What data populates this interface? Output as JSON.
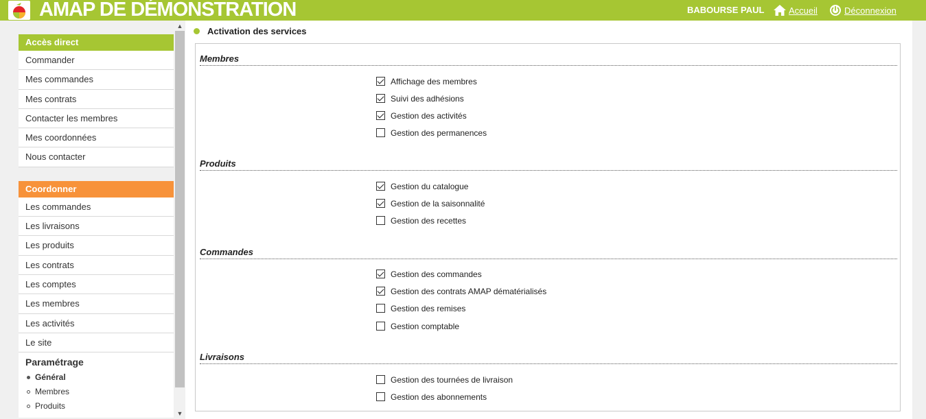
{
  "header": {
    "app_title": "AMAP DE DÉMONSTRATION",
    "user_name": "BABOURSE PAUL",
    "home_link": "Accueil",
    "logout_link": "Déconnexion",
    "brand_color": "#a6c633"
  },
  "sidebar": {
    "direct_access": {
      "title": "Accès direct",
      "items": [
        {
          "label": "Commander"
        },
        {
          "label": "Mes commandes"
        },
        {
          "label": "Mes contrats"
        },
        {
          "label": "Contacter les membres"
        },
        {
          "label": "Mes coordonnées"
        },
        {
          "label": "Nous contacter"
        }
      ]
    },
    "coordinate": {
      "title": "Coordonner",
      "color": "#f7923a",
      "items": [
        {
          "label": "Les commandes"
        },
        {
          "label": "Les livraisons"
        },
        {
          "label": "Les produits"
        },
        {
          "label": "Les contrats"
        },
        {
          "label": "Les comptes"
        },
        {
          "label": "Les membres"
        },
        {
          "label": "Les activités"
        },
        {
          "label": "Le site"
        }
      ]
    },
    "settings": {
      "title": "Paramétrage",
      "items": [
        {
          "label": "Général",
          "active": true
        },
        {
          "label": "Membres",
          "active": false
        },
        {
          "label": "Produits",
          "active": false
        }
      ]
    }
  },
  "main": {
    "title": "Activation des services",
    "groups": [
      {
        "title": "Membres",
        "services": [
          {
            "label": "Affichage des membres",
            "checked": true
          },
          {
            "label": "Suivi des adhésions",
            "checked": true
          },
          {
            "label": "Gestion des activités",
            "checked": true
          },
          {
            "label": "Gestion des permanences",
            "checked": false
          }
        ]
      },
      {
        "title": "Produits",
        "services": [
          {
            "label": "Gestion du catalogue",
            "checked": true
          },
          {
            "label": "Gestion de la saisonnalité",
            "checked": true
          },
          {
            "label": "Gestion des recettes",
            "checked": false
          }
        ]
      },
      {
        "title": "Commandes",
        "services": [
          {
            "label": "Gestion des commandes",
            "checked": true
          },
          {
            "label": "Gestion des contrats AMAP dématérialisés",
            "checked": true
          },
          {
            "label": "Gestion des remises",
            "checked": false
          },
          {
            "label": "Gestion comptable",
            "checked": false
          }
        ]
      },
      {
        "title": "Livraisons",
        "services": [
          {
            "label": "Gestion des tournées de livraison",
            "checked": false
          },
          {
            "label": "Gestion des abonnements",
            "checked": false
          }
        ]
      }
    ]
  }
}
